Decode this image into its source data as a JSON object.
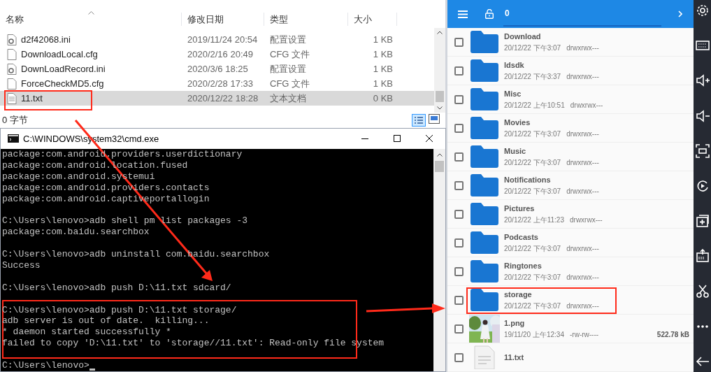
{
  "explorer": {
    "columns": [
      "名称",
      "修改日期",
      "类型",
      "大小"
    ],
    "rows": [
      {
        "name": "d2f42068.ini",
        "date": "2019/11/24 20:54",
        "type": "配置设置",
        "size": "1 KB",
        "kind": "settings",
        "selected": false
      },
      {
        "name": "DownloadLocal.cfg",
        "date": "2020/2/16 20:49",
        "type": "CFG 文件",
        "size": "1 KB",
        "kind": "file",
        "selected": false
      },
      {
        "name": "DownLoadRecord.ini",
        "date": "2020/3/6 18:25",
        "type": "配置设置",
        "size": "1 KB",
        "kind": "settings",
        "selected": false
      },
      {
        "name": "ForceCheckMD5.cfg",
        "date": "2020/2/28 17:33",
        "type": "CFG 文件",
        "size": "1 KB",
        "kind": "file",
        "selected": false
      },
      {
        "name": "11.txt",
        "date": "2020/12/22 18:28",
        "type": "文本文档",
        "size": "0 KB",
        "kind": "text",
        "selected": true
      }
    ],
    "status": "0 字节"
  },
  "cmd": {
    "title": "C:\\WINDOWS\\system32\\cmd.exe",
    "blocks": [
      [
        "package:com.android.providers.userdictionary",
        "package:com.android.location.fused",
        "package:com.android.systemui",
        "package:com.android.providers.contacts",
        "package:com.android.captiveportallogin"
      ],
      [
        "C:\\Users\\lenovo>adb shell pm list packages -3",
        "package:com.baidu.searchbox"
      ],
      [
        "C:\\Users\\lenovo>adb uninstall com.baidu.searchbox",
        "Success"
      ],
      [
        "C:\\Users\\lenovo>adb push D:\\11.txt sdcard/"
      ],
      [
        "C:\\Users\\lenovo>adb push D:\\11.txt storage/",
        "adb server is out of date.  killing...",
        "* daemon started successfully *",
        "failed to copy 'D:\\11.txt' to 'storage//11.txt': Read-only file system"
      ],
      [
        "C:\\Users\\lenovo>"
      ]
    ]
  },
  "files_app": {
    "path": "0",
    "items": [
      {
        "name": "Download",
        "meta": "20/12/22 下午3:07",
        "perm": "drwxrwx---",
        "kind": "folder",
        "checked": false
      },
      {
        "name": "ldsdk",
        "meta": "20/12/22 下午3:37",
        "perm": "drwxrwx---",
        "kind": "folder",
        "checked": false
      },
      {
        "name": "Misc",
        "meta": "20/12/22 上午10:51",
        "perm": "drwxrwx---",
        "kind": "folder",
        "checked": false
      },
      {
        "name": "Movies",
        "meta": "20/12/22 下午3:07",
        "perm": "drwxrwx---",
        "kind": "folder",
        "checked": false
      },
      {
        "name": "Music",
        "meta": "20/12/22 下午3:07",
        "perm": "drwxrwx---",
        "kind": "folder",
        "checked": false
      },
      {
        "name": "Notifications",
        "meta": "20/12/22 下午3:07",
        "perm": "drwxrwx---",
        "kind": "folder",
        "checked": false
      },
      {
        "name": "Pictures",
        "meta": "20/12/22 上午11:23",
        "perm": "drwxrwx---",
        "kind": "folder",
        "checked": false
      },
      {
        "name": "Podcasts",
        "meta": "20/12/22 下午3:07",
        "perm": "drwxrwx---",
        "kind": "folder",
        "checked": false
      },
      {
        "name": "Ringtones",
        "meta": "20/12/22 下午3:07",
        "perm": "drwxrwx---",
        "kind": "folder",
        "checked": false
      },
      {
        "name": "storage",
        "meta": "20/12/22 下午3:07",
        "perm": "drwxrwx---",
        "kind": "folder",
        "checked": false
      },
      {
        "name": "1.png",
        "meta": "19/11/20 上午12:34",
        "perm": "-rw-rw----",
        "size": "522.78 kB",
        "checked": false
      },
      {
        "name": "11.txt",
        "kind": "document",
        "checked": false
      }
    ]
  }
}
